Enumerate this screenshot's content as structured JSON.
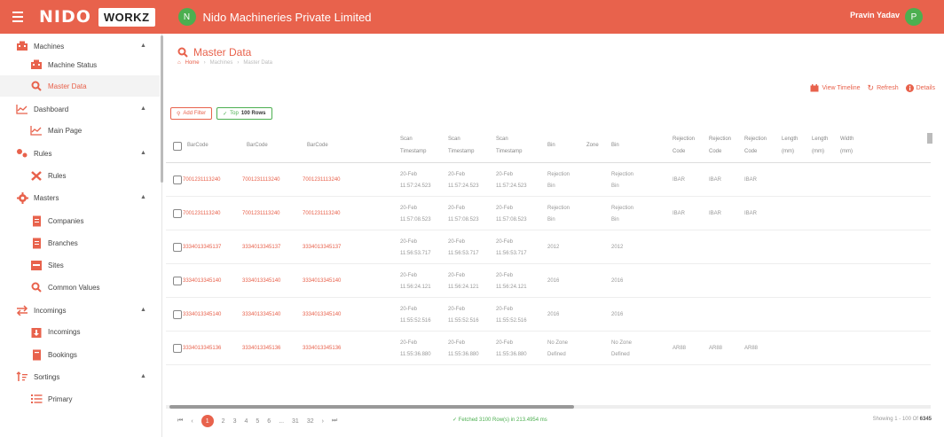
{
  "header": {
    "brand": "NIDO",
    "product": "WORKZ",
    "org_initial": "N",
    "org_name": "Nido Machineries Private Limited",
    "user_name": "Pravin Yadav",
    "user_initial": "P",
    "bar_color": "#e8624c"
  },
  "sidebar": {
    "items": [
      {
        "label": "Machines",
        "icon": "machine-icon",
        "level": "top",
        "caret": "▲"
      },
      {
        "label": "Machine Status",
        "icon": "machine-icon",
        "level": "sub"
      },
      {
        "label": "Master Data",
        "icon": "search-icon",
        "level": "sub",
        "active": true
      },
      {
        "label": "Dashboard",
        "icon": "chart-line-icon",
        "level": "top",
        "caret": "▲"
      },
      {
        "label": "Main Page",
        "icon": "chart-line-icon",
        "level": "sub"
      },
      {
        "label": "Rules",
        "icon": "rules-icon",
        "level": "top",
        "caret": "▲"
      },
      {
        "label": "Rules",
        "icon": "tools-icon",
        "level": "sub"
      },
      {
        "label": "Masters",
        "icon": "gear-icon",
        "level": "top",
        "caret": "▲"
      },
      {
        "label": "Companies",
        "icon": "document-icon",
        "level": "sub"
      },
      {
        "label": "Branches",
        "icon": "document-icon",
        "level": "sub"
      },
      {
        "label": "Sites",
        "icon": "building-icon",
        "level": "sub"
      },
      {
        "label": "Common Values",
        "icon": "search-icon",
        "level": "sub"
      },
      {
        "label": "Incomings",
        "icon": "swap-icon",
        "level": "top",
        "caret": "▲"
      },
      {
        "label": "Incomings",
        "icon": "download-icon",
        "level": "sub"
      },
      {
        "label": "Bookings",
        "icon": "book-icon",
        "level": "sub"
      },
      {
        "label": "Sortings",
        "icon": "sort-icon",
        "level": "top",
        "caret": "▲"
      },
      {
        "label": "Primary",
        "icon": "list-icon",
        "level": "sub"
      }
    ]
  },
  "page": {
    "title": "Master Data",
    "breadcrumb": [
      "Home",
      "Machines",
      "Master Data"
    ]
  },
  "actions": {
    "view_timeline": "View Timeline",
    "refresh": "Refresh",
    "details": "Details"
  },
  "chips": {
    "add_filter": "Add Filter",
    "top_label": "Top",
    "top_value": "100 Rows"
  },
  "table": {
    "headers": [
      [
        "BarCode"
      ],
      [
        "BarCode"
      ],
      [
        "BarCode"
      ],
      [
        "Scan",
        "Timestamp"
      ],
      [
        "Scan",
        "Timestamp"
      ],
      [
        "Scan",
        "Timestamp"
      ],
      [
        "Bin"
      ],
      [
        "Zone"
      ],
      [
        "Bin"
      ],
      [
        "Rejection",
        "Code"
      ],
      [
        "Rejection",
        "Code"
      ],
      [
        "Rejection",
        "Code"
      ],
      [
        "Length",
        "(mm)"
      ],
      [
        "Length",
        "(mm)"
      ],
      [
        "Width",
        "(mm)"
      ]
    ],
    "rows": [
      {
        "codes": [
          "7001231113240",
          "7001231113240",
          "7001231113240"
        ],
        "times": [
          [
            "20-Feb",
            "11:57:24.523"
          ],
          [
            "20-Feb",
            "11:57:24.523"
          ],
          [
            "20-Feb",
            "11:57:24.523"
          ]
        ],
        "bin": [
          "Rejection",
          "Bin"
        ],
        "zone": "",
        "bin2": [
          "Rejection",
          "Bin"
        ],
        "rej": [
          "IBAR",
          "IBAR",
          "IBAR"
        ],
        "len1": "",
        "len2": "",
        "width": ""
      },
      {
        "codes": [
          "7001231113240",
          "7001231113240",
          "7001231113240"
        ],
        "times": [
          [
            "20-Feb",
            "11:57:08.523"
          ],
          [
            "20-Feb",
            "11:57:08.523"
          ],
          [
            "20-Feb",
            "11:57:08.523"
          ]
        ],
        "bin": [
          "Rejection",
          "Bin"
        ],
        "zone": "",
        "bin2": [
          "Rejection",
          "Bin"
        ],
        "rej": [
          "IBAR",
          "IBAR",
          "IBAR"
        ],
        "len1": "",
        "len2": "",
        "width": ""
      },
      {
        "codes": [
          "3334013345137",
          "3334013345137",
          "3334013345137"
        ],
        "times": [
          [
            "20-Feb",
            "11:56:53.717"
          ],
          [
            "20-Feb",
            "11:56:53.717"
          ],
          [
            "20-Feb",
            "11:56:53.717"
          ]
        ],
        "bin": [
          "2012"
        ],
        "zone": "",
        "bin2": [
          "2012"
        ],
        "rej": [
          "",
          "",
          ""
        ],
        "len1": "",
        "len2": "",
        "width": ""
      },
      {
        "codes": [
          "3334013345140",
          "3334013345140",
          "3334013345140"
        ],
        "times": [
          [
            "20-Feb",
            "11:56:24.121"
          ],
          [
            "20-Feb",
            "11:56:24.121"
          ],
          [
            "20-Feb",
            "11:56:24.121"
          ]
        ],
        "bin": [
          "2016"
        ],
        "zone": "",
        "bin2": [
          "2016"
        ],
        "rej": [
          "",
          "",
          ""
        ],
        "len1": "",
        "len2": "",
        "width": ""
      },
      {
        "codes": [
          "3334013345140",
          "3334013345140",
          "3334013345140"
        ],
        "times": [
          [
            "20-Feb",
            "11:55:52.516"
          ],
          [
            "20-Feb",
            "11:55:52.516"
          ],
          [
            "20-Feb",
            "11:55:52.516"
          ]
        ],
        "bin": [
          "2016"
        ],
        "zone": "",
        "bin2": [
          "2016"
        ],
        "rej": [
          "",
          "",
          ""
        ],
        "len1": "",
        "len2": "",
        "width": ""
      },
      {
        "codes": [
          "3334013345136",
          "3334013345136",
          "3334013345136"
        ],
        "times": [
          [
            "20-Feb",
            "11:55:36.880"
          ],
          [
            "20-Feb",
            "11:55:36.880"
          ],
          [
            "20-Feb",
            "11:55:36.880"
          ]
        ],
        "bin": [
          "No Zone",
          "Defined"
        ],
        "zone": "",
        "bin2": [
          "No Zone",
          "Defined"
        ],
        "rej": [
          "AR88",
          "AR88",
          "AR88"
        ],
        "len1": "",
        "len2": "",
        "width": ""
      }
    ]
  },
  "pagination": {
    "prev_first": "⏮",
    "prev": "‹",
    "pages": [
      "1",
      "2",
      "3",
      "4",
      "5",
      "6",
      "...",
      "31",
      "32"
    ],
    "active_page": "1",
    "next": "›",
    "next_last": "⏭"
  },
  "status": {
    "fetch_message": "✓ Fetched 3100 Row(s) in 213.4954 ms",
    "showing_prefix": "Showing 1 - 100 Of",
    "showing_total": "6345"
  }
}
